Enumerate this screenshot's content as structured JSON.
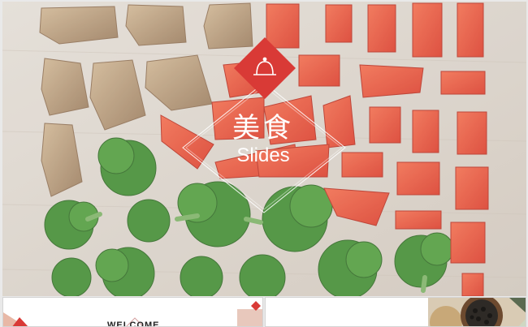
{
  "hero": {
    "title_cn": "美食",
    "title_en": "Slides",
    "badge_icon": "food-cloche-icon",
    "accent": "#d93a36",
    "frame_color": "#ffffff"
  },
  "thumbnails": [
    {
      "label": "WELCOME"
    }
  ]
}
